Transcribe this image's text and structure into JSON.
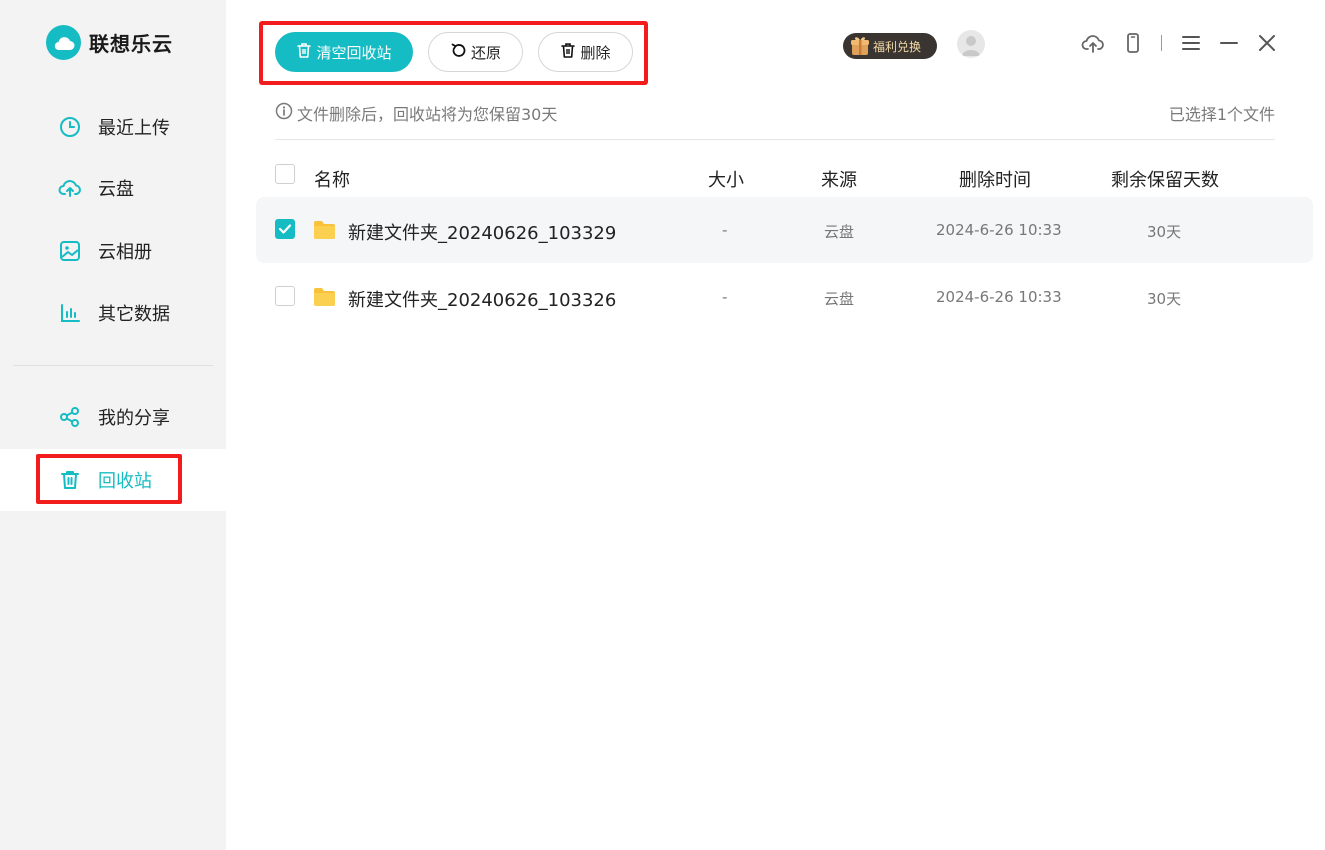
{
  "app": {
    "name": "联想乐云"
  },
  "sidebar": {
    "items": [
      {
        "label": "最近上传",
        "icon": "clock-icon"
      },
      {
        "label": "云盘",
        "icon": "cloud-upload-icon"
      },
      {
        "label": "云相册",
        "icon": "image-icon"
      },
      {
        "label": "其它数据",
        "icon": "bar-chart-icon"
      },
      {
        "label": "我的分享",
        "icon": "share-icon"
      },
      {
        "label": "回收站",
        "icon": "trash-icon",
        "active": true
      }
    ]
  },
  "toolbar": {
    "empty_label": "清空回收站",
    "restore_label": "还原",
    "delete_label": "删除"
  },
  "header": {
    "badge_label": "福利兑换"
  },
  "notice": {
    "text": "文件删除后，回收站将为您保留30天",
    "selected": "已选择1个文件"
  },
  "table": {
    "columns": [
      "名称",
      "大小",
      "来源",
      "删除时间",
      "剩余保留天数"
    ],
    "rows": [
      {
        "name": "新建文件夹_20240626_103329",
        "size": "-",
        "source": "云盘",
        "deleted": "2024-6-26 10:33",
        "remaining": "30天",
        "checked": true
      },
      {
        "name": "新建文件夹_20240626_103326",
        "size": "-",
        "source": "云盘",
        "deleted": "2024-6-26 10:33",
        "remaining": "30天",
        "checked": false
      }
    ]
  },
  "colors": {
    "accent": "#16bcc3",
    "highlight": "#f21c1c",
    "folder": "#f8c33b"
  }
}
